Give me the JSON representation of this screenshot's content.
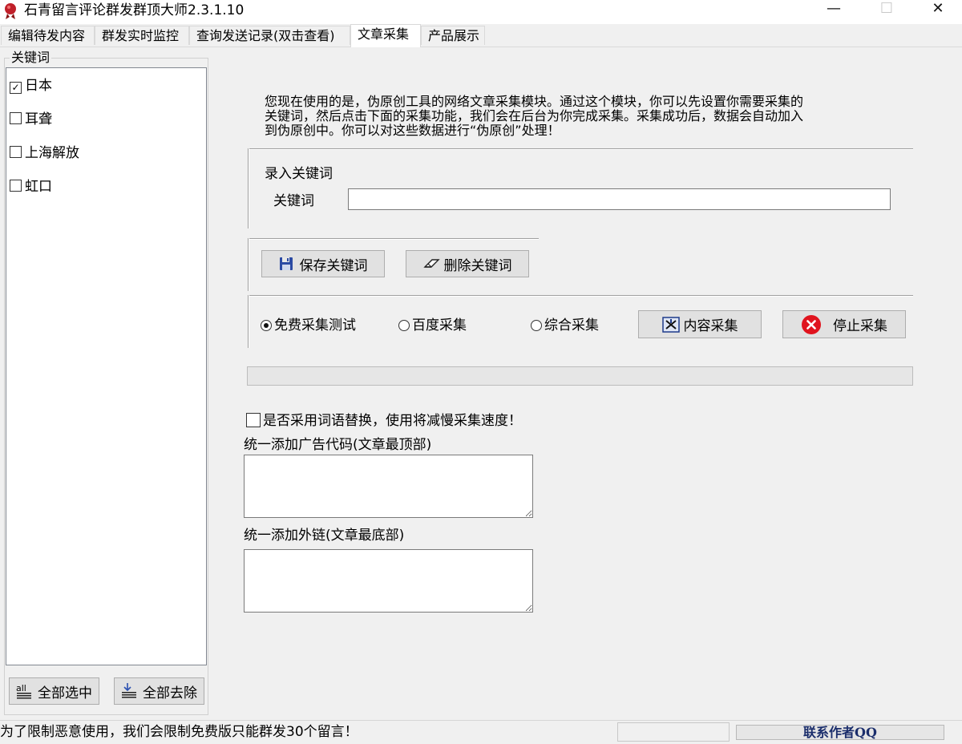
{
  "window": {
    "title": "石青留言评论群发群顶大师2.3.1.10",
    "minimize_glyph": "—",
    "maximize_glyph": "☐",
    "close_glyph": "✕"
  },
  "tabs": [
    {
      "label": "编辑待发内容"
    },
    {
      "label": "群发实时监控"
    },
    {
      "label": "查询发送记录(双击查看)"
    },
    {
      "label": "文章采集",
      "active": true
    },
    {
      "label": "产品展示"
    }
  ],
  "keywords": {
    "legend": "关键词",
    "items": [
      {
        "label": "日本",
        "checked": true
      },
      {
        "label": "耳聋",
        "checked": false
      },
      {
        "label": "上海解放",
        "checked": false
      },
      {
        "label": "虹口",
        "checked": false
      }
    ],
    "select_all_label": "全部选中",
    "clear_all_label": "全部去除"
  },
  "main": {
    "intro_line1": "您现在使用的是，伪原创工具的网络文章采集模块。通过这个模块，你可以先设置你需要采集的",
    "intro_line2": "关键词，然后点击下面的采集功能，我们会在后台为你完成采集。采集成功后，数据会自动加入",
    "intro_line3": "到伪原创中。你可以对这些数据进行“伪原创”处理！",
    "entry_group_label": "录入关键词",
    "keyword_field_label": "关键词",
    "keyword_field_value": "",
    "save_keyword_label": "保存关键词",
    "delete_keyword_label": "删除关键词",
    "modes": [
      {
        "label": "免费采集测试",
        "selected": true
      },
      {
        "label": "百度采集",
        "selected": false
      },
      {
        "label": "综合采集",
        "selected": false
      }
    ],
    "collect_button_label": "内容采集",
    "stop_button_label": "停止采集",
    "progress": 0,
    "replace_words_label": "是否采用词语替换，使用将减慢采集速度！",
    "replace_words_checked": false,
    "ad_code_label": "统一添加广告代码(文章最顶部)",
    "ad_code_value": "",
    "external_link_label": "统一添加外链(文章最底部)",
    "external_link_value": ""
  },
  "status": {
    "message": "为了限制恶意使用，我们会限制免费版只能群发30个留言！",
    "contact_label": "联系作者QQ"
  },
  "colors": {
    "accent_stop": "#e0141e",
    "save_icon": "#2b4aa3"
  }
}
